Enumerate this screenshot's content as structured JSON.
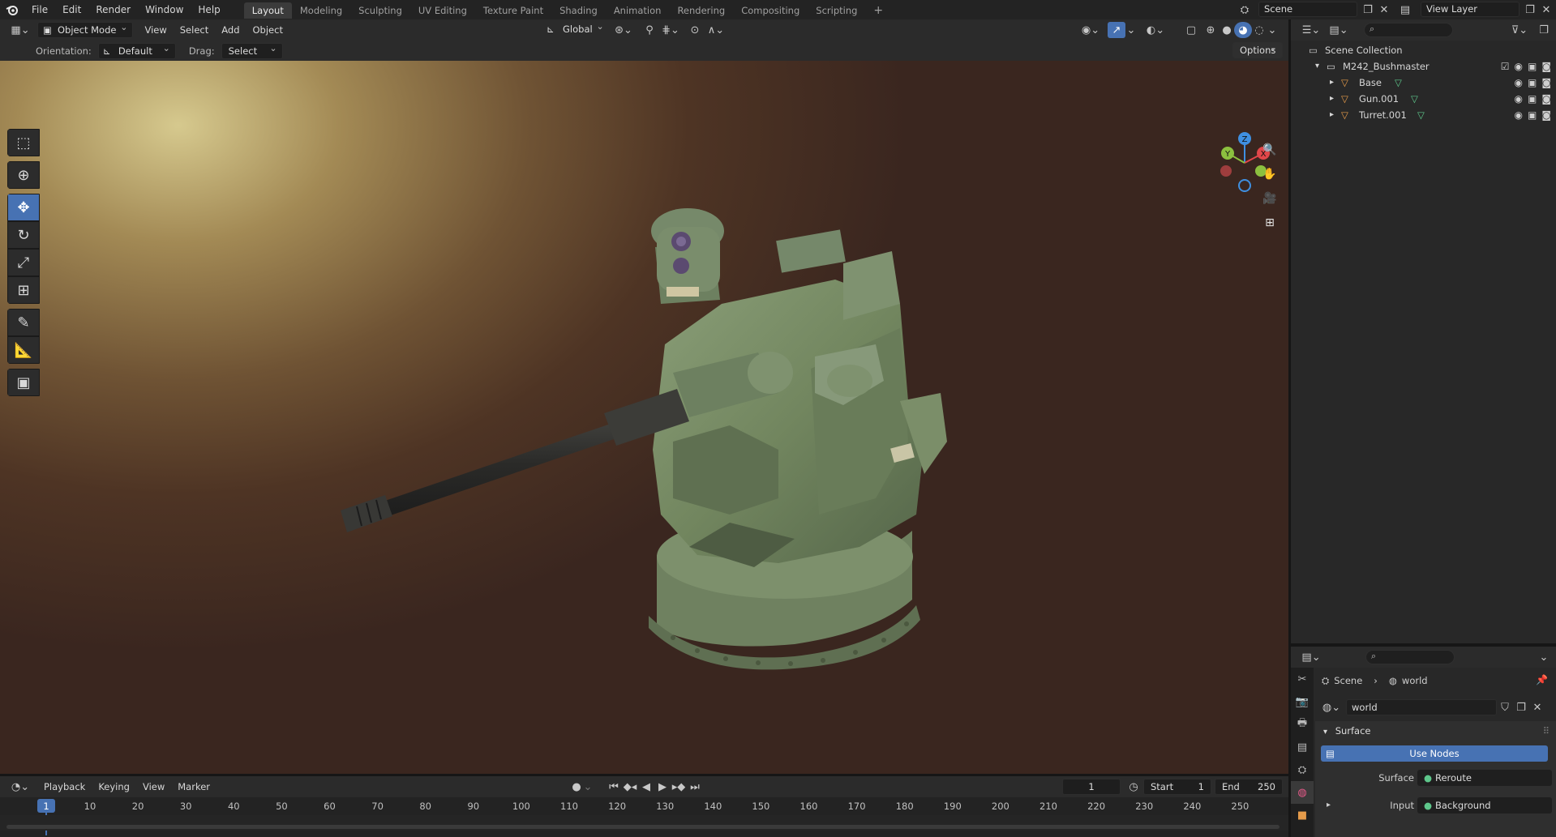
{
  "topbar": {
    "menus": [
      "File",
      "Edit",
      "Render",
      "Window",
      "Help"
    ],
    "workspaces": [
      "Layout",
      "Modeling",
      "Sculpting",
      "UV Editing",
      "Texture Paint",
      "Shading",
      "Animation",
      "Rendering",
      "Compositing",
      "Scripting"
    ],
    "active_workspace": "Layout",
    "add_tab": "+",
    "scene_name": "Scene",
    "view_layer": "View Layer"
  },
  "viewport_header": {
    "mode": "Object Mode",
    "menus": [
      "View",
      "Select",
      "Add",
      "Object"
    ],
    "transform_orientation": "Global"
  },
  "tool_header": {
    "orientation_label": "Orientation:",
    "orientation_value": "Default",
    "drag_label": "Drag:",
    "drag_value": "Select Box",
    "options_label": "Options"
  },
  "toolbar": {
    "tools": [
      "select-box",
      "cursor",
      "move",
      "rotate",
      "scale",
      "transform",
      "annotate",
      "measure",
      "add-cube"
    ],
    "active_tool": "move"
  },
  "gizmo": {
    "x": "X",
    "y": "Y",
    "z": "Z"
  },
  "outliner": {
    "root": "Scene Collection",
    "collection": "M242_Bushmaster",
    "objects": [
      "Base",
      "Gun.001",
      "Turret.001"
    ]
  },
  "properties": {
    "breadcrumb_scene": "Scene",
    "breadcrumb_world": "world",
    "world_name": "world",
    "panel_surface": "Surface",
    "use_nodes_label": "Use Nodes",
    "surface_label": "Surface",
    "surface_value": "Reroute",
    "input_label": "Input",
    "input_value": "Background"
  },
  "timeline": {
    "menus": [
      "Playback",
      "Keying",
      "View",
      "Marker"
    ],
    "current_frame": "1",
    "start_label": "Start",
    "start_value": "1",
    "end_label": "End",
    "end_value": "250",
    "ticks": [
      "1",
      "10",
      "20",
      "30",
      "40",
      "50",
      "60",
      "70",
      "80",
      "90",
      "100",
      "110",
      "120",
      "130",
      "140",
      "150",
      "160",
      "170",
      "180",
      "190",
      "200",
      "210",
      "220",
      "230",
      "240",
      "250"
    ]
  },
  "colors": {
    "accent": "#4772b3",
    "header": "#2b2b2b",
    "panel": "#282828",
    "turret_green": "#7a8f6a",
    "axis_x": "#e2474a",
    "axis_y": "#8cc03f",
    "axis_z": "#3f8fe0"
  }
}
